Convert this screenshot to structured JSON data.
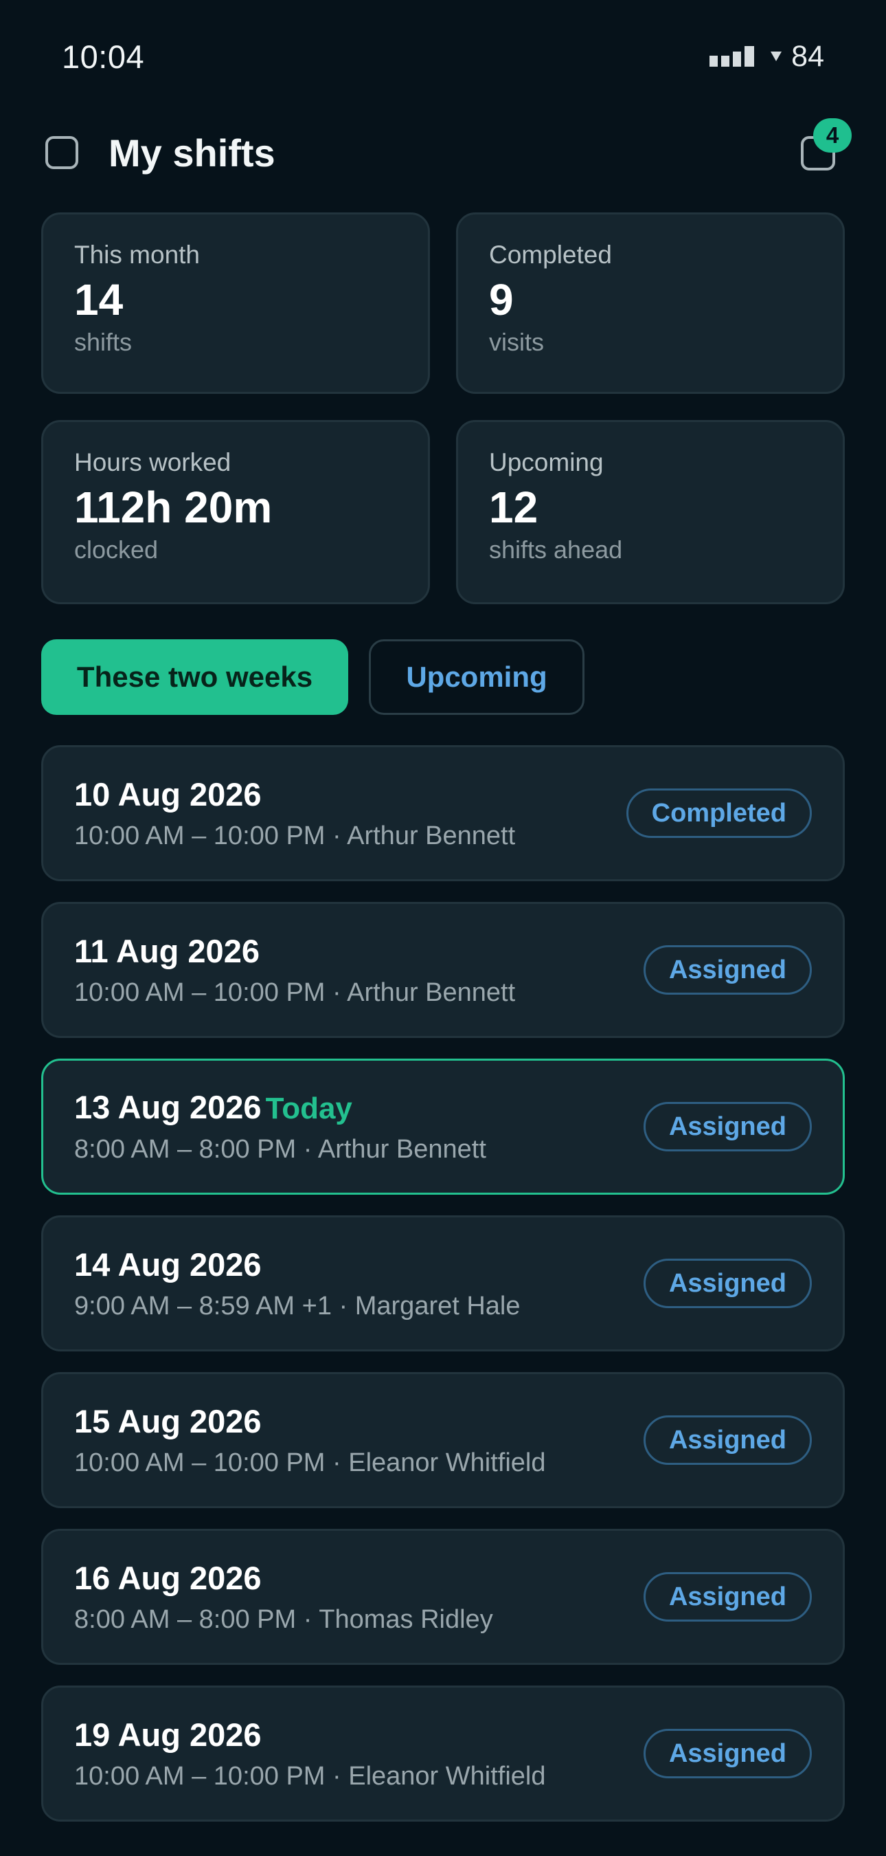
{
  "status_bar": {
    "time": "10:04",
    "battery": "84"
  },
  "header": {
    "title": "My shifts",
    "notification_count": "4"
  },
  "stats": [
    {
      "label": "This month",
      "value": "14",
      "sub": "shifts"
    },
    {
      "label": "Completed",
      "value": "9",
      "sub": "visits"
    },
    {
      "label": "Hours worked",
      "value": "112h 20m",
      "sub": "clocked"
    },
    {
      "label": "Upcoming",
      "value": "12",
      "sub": "shifts ahead"
    }
  ],
  "tabs": [
    {
      "label": "These two weeks",
      "active": true
    },
    {
      "label": "Upcoming",
      "active": false
    }
  ],
  "today_label": "Today",
  "shifts": [
    {
      "date": "10 Aug 2026",
      "detail": "10:00 AM – 10:00 PM · Arthur Bennett",
      "status": "Completed",
      "today": false
    },
    {
      "date": "11 Aug 2026",
      "detail": "10:00 AM – 10:00 PM · Arthur Bennett",
      "status": "Assigned",
      "today": false
    },
    {
      "date": "13 Aug 2026",
      "detail": "8:00 AM – 8:00 PM · Arthur Bennett",
      "status": "Assigned",
      "today": true
    },
    {
      "date": "14 Aug 2026",
      "detail": "9:00 AM – 8:59 AM +1 · Margaret Hale",
      "status": "Assigned",
      "today": false
    },
    {
      "date": "15 Aug 2026",
      "detail": "10:00 AM – 10:00 PM · Eleanor Whitfield",
      "status": "Assigned",
      "today": false
    },
    {
      "date": "16 Aug 2026",
      "detail": "8:00 AM – 8:00 PM · Thomas Ridley",
      "status": "Assigned",
      "today": false
    },
    {
      "date": "19 Aug 2026",
      "detail": "10:00 AM – 10:00 PM · Eleanor Whitfield",
      "status": "Assigned",
      "today": false
    }
  ]
}
